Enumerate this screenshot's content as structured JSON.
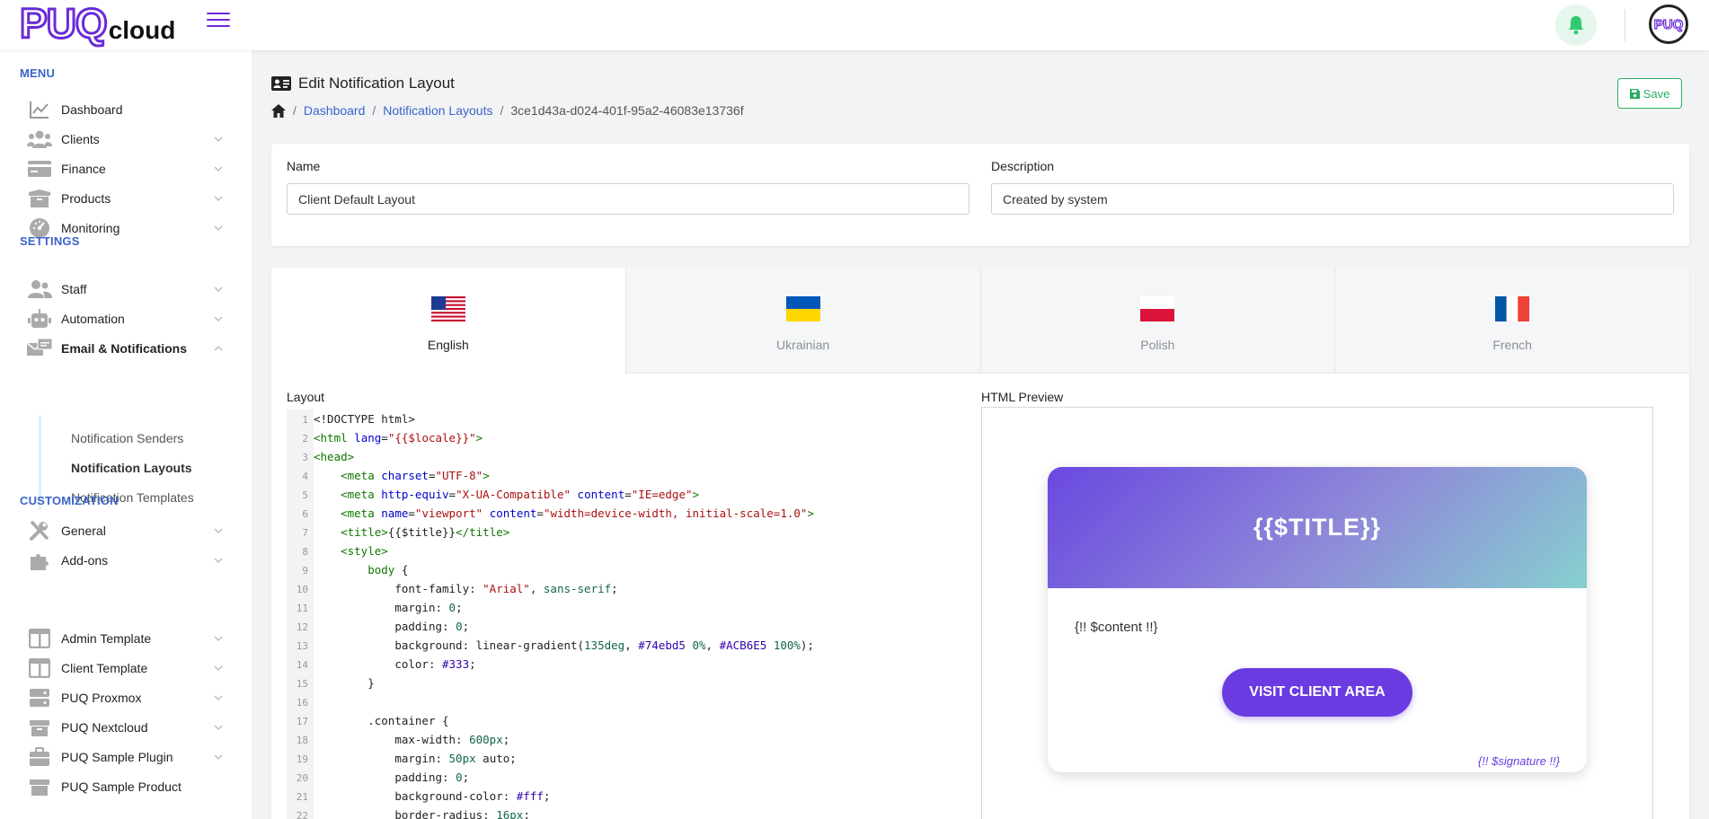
{
  "header": {
    "logo_main": "PUQ",
    "logo_sub": "cloud",
    "avatar_text": "PUQ"
  },
  "sidebar": {
    "sections": {
      "menu": "MENU",
      "settings": "SETTINGS",
      "customization": "CUSTOMIZATION"
    },
    "items": [
      {
        "label": "Dashboard",
        "icon": "chart-line-icon"
      },
      {
        "label": "Clients",
        "icon": "users-icon"
      },
      {
        "label": "Finance",
        "icon": "credit-card-icon"
      },
      {
        "label": "Products",
        "icon": "box-icon"
      },
      {
        "label": "Monitoring",
        "icon": "gauge-icon"
      },
      {
        "label": "Staff",
        "icon": "staff-icon"
      },
      {
        "label": "Automation",
        "icon": "robot-icon"
      },
      {
        "label": "Email & Notifications",
        "icon": "mail-icon"
      },
      {
        "label": "General",
        "icon": "tools-icon"
      },
      {
        "label": "Add-ons",
        "icon": "puzzle-icon"
      },
      {
        "label": "Admin Template",
        "icon": "layout-icon"
      },
      {
        "label": "Client Template",
        "icon": "layout-icon"
      },
      {
        "label": "PUQ Proxmox",
        "icon": "server-icon"
      },
      {
        "label": "PUQ Nextcloud",
        "icon": "box-icon"
      },
      {
        "label": "PUQ Sample Plugin",
        "icon": "briefcase-icon"
      },
      {
        "label": "PUQ Sample Product",
        "icon": "box-icon"
      }
    ],
    "sub_items": [
      {
        "label": "Notification Senders"
      },
      {
        "label": "Notification Layouts"
      },
      {
        "label": "Notification Templates"
      }
    ]
  },
  "page": {
    "title": "Edit Notification Layout",
    "breadcrumb": [
      "Dashboard",
      "Notification Layouts",
      "3ce1d43a-d024-401f-95a2-46083e13736f"
    ],
    "save_label": "Save"
  },
  "form": {
    "name_label": "Name",
    "name_value": "Client Default Layout",
    "description_label": "Description",
    "description_value": "Created by system"
  },
  "tabs": [
    {
      "label": "English",
      "flag": "us-flag-icon"
    },
    {
      "label": "Ukrainian",
      "flag": "ua-flag-icon"
    },
    {
      "label": "Polish",
      "flag": "pl-flag-icon"
    },
    {
      "label": "French",
      "flag": "fr-flag-icon"
    }
  ],
  "editor": {
    "label": "Layout",
    "line_numbers": [
      "1",
      "2",
      "3",
      "4",
      "5",
      "6",
      "7",
      "8",
      "9",
      "10",
      "11",
      "12",
      "13",
      "14",
      "15",
      "16",
      "17",
      "18",
      "19",
      "20",
      "21",
      "22"
    ]
  },
  "preview": {
    "label": "HTML Preview",
    "title": "{{$TITLE}}",
    "content": "{!! $content !!}",
    "button": "VISIT CLIENT AREA",
    "signature": "{!! $signature !!}"
  },
  "colors": {
    "accent": "#6a2ad8",
    "link": "#3b64c9",
    "success": "#27ae60"
  }
}
